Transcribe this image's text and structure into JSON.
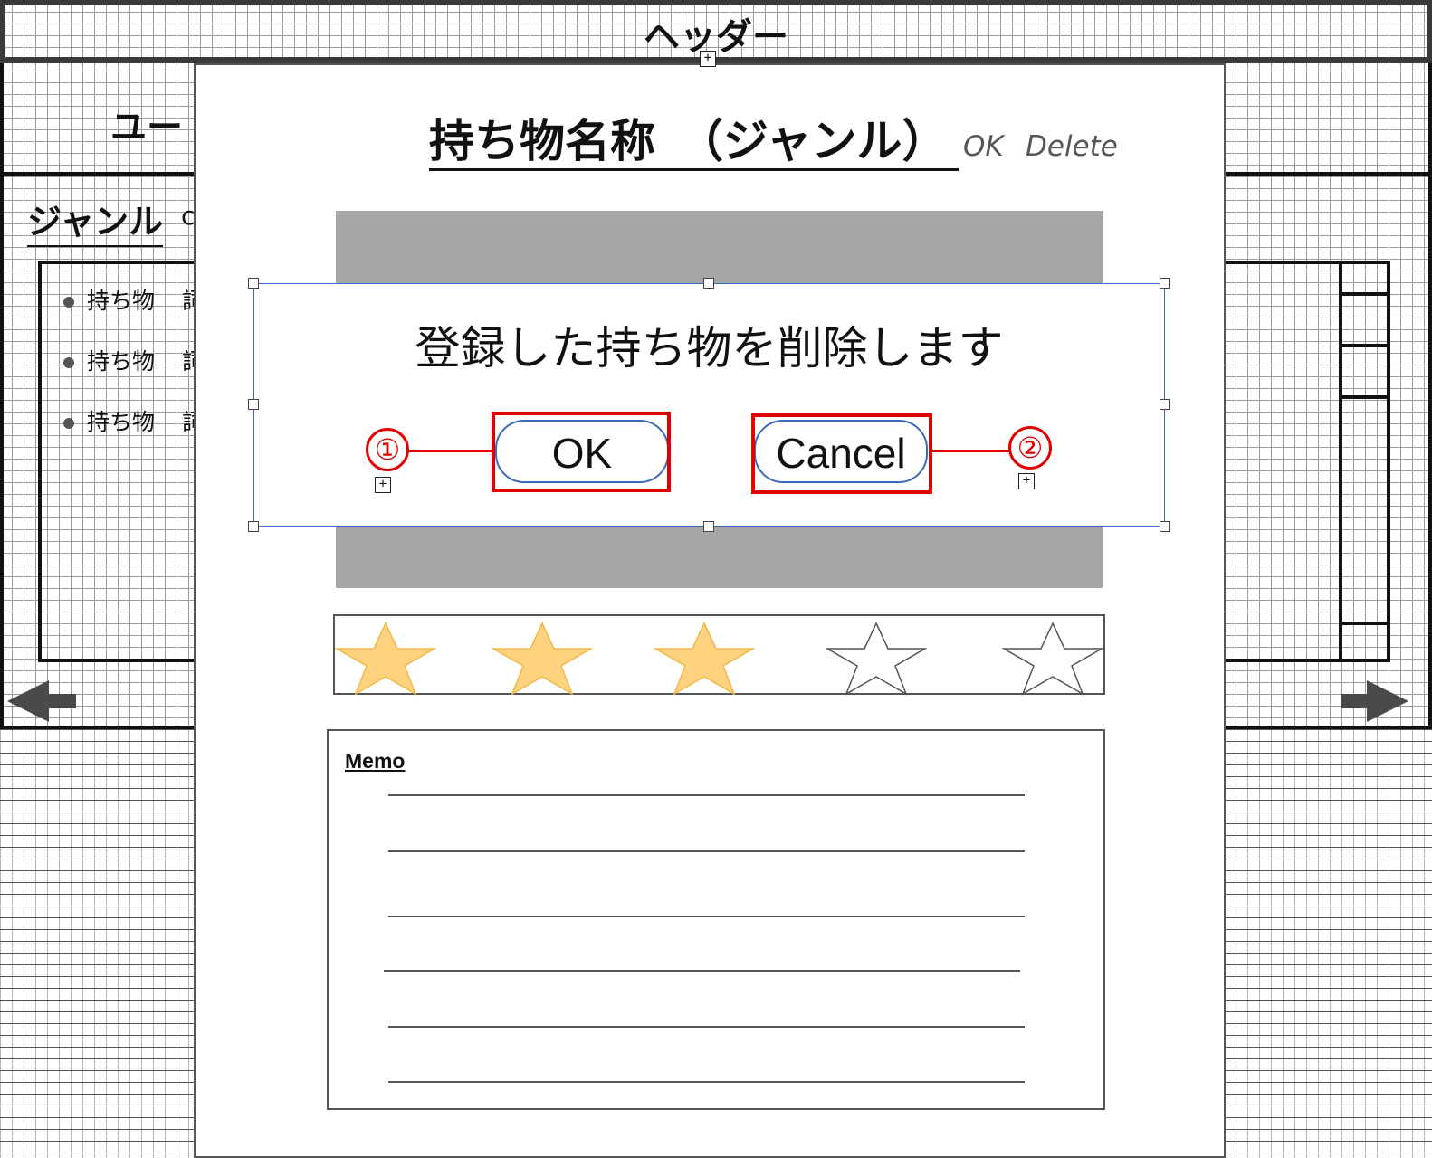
{
  "header": {
    "title": "ヘッダー"
  },
  "background": {
    "user_text": "ユー",
    "genre_label": "ジャンル",
    "genre_extra": "c",
    "list_items": [
      {
        "label": "持ち物",
        "suffix": "詞"
      },
      {
        "label": "持ち物",
        "suffix": "詞"
      },
      {
        "label": "持ち物",
        "suffix": "詞"
      }
    ]
  },
  "modal": {
    "title": "持ち物名称　（ジャンル）",
    "ok_link": "OK",
    "delete_link": "Delete",
    "rating": {
      "value": 3,
      "max": 5
    },
    "memo_label": "Memo"
  },
  "dialog": {
    "message": "登録した持ち物を削除します",
    "ok_button": "OK",
    "cancel_button": "Cancel",
    "callouts": [
      "①",
      "②"
    ]
  },
  "handles": {
    "plus_symbol": "+"
  },
  "colors": {
    "star_filled": "#ffd27f",
    "star_filled_stroke": "#f0b94a",
    "star_empty_stroke": "#555555",
    "highlight": "#e00000",
    "selection": "#2f6fd0"
  }
}
